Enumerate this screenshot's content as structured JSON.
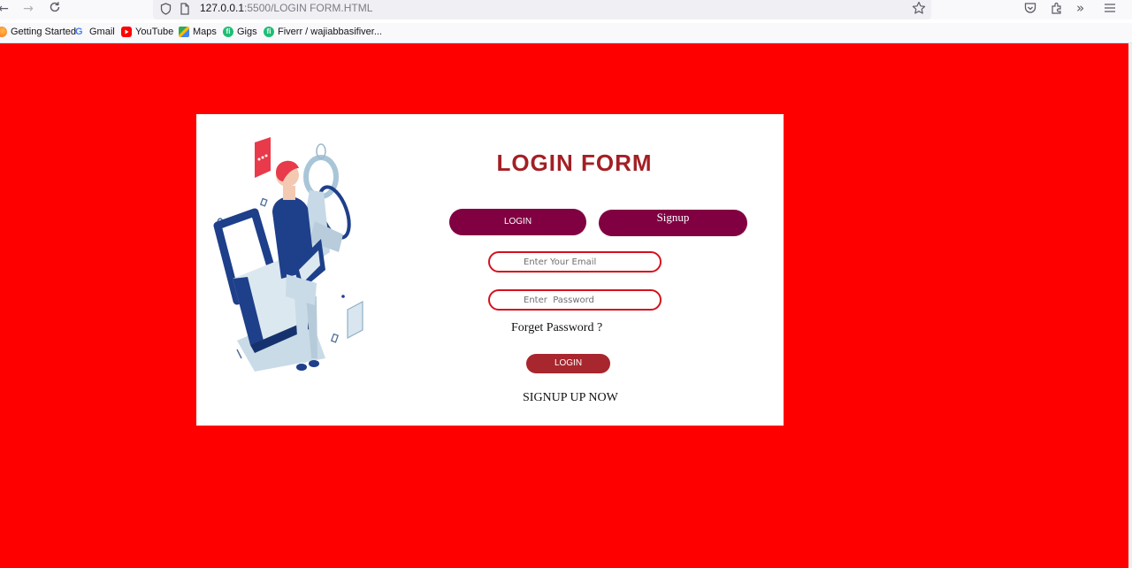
{
  "browser": {
    "url_host": "127.0.0.1",
    "url_path": ":5500/LOGIN FORM.HTML",
    "bookmarks": [
      {
        "label": "Getting Started",
        "icon": "firefox-icon"
      },
      {
        "label": "Gmail",
        "icon": "google-icon"
      },
      {
        "label": "YouTube",
        "icon": "youtube-icon"
      },
      {
        "label": "Maps",
        "icon": "maps-icon"
      },
      {
        "label": "Gigs",
        "icon": "fiverr-icon"
      },
      {
        "label": "Fiverr / wajiabbasifiver...",
        "icon": "fiverr-icon"
      }
    ]
  },
  "colors": {
    "page_bg": "#ff0000",
    "title": "#a31f25",
    "tab_bg": "#800042",
    "field_border": "#d4111c",
    "login_button": "#a8262d"
  },
  "form": {
    "title": "LOGIN FORM",
    "tab_login": "LOGIN",
    "tab_signup": "Signup",
    "email_placeholder": "Enter Your Email",
    "password_placeholder": "Enter  Password",
    "forget_password": "Forget Password ?",
    "login_button": "LOGIN",
    "signup_link": "SIGNUP UP NOW"
  }
}
